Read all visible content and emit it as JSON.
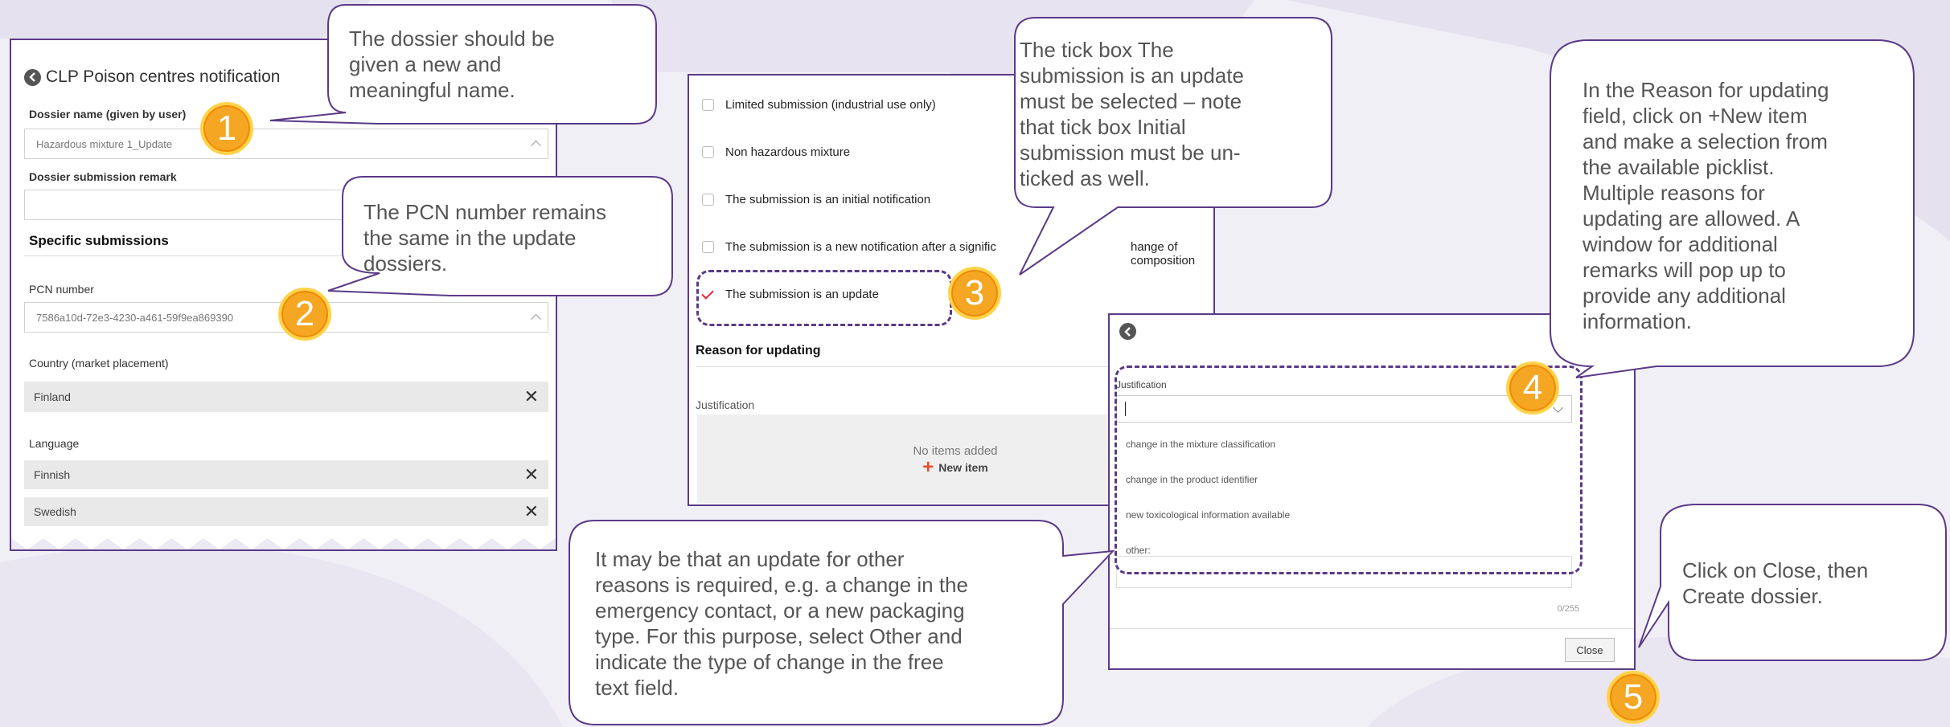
{
  "panel1": {
    "title": "CLP Poison centres notification",
    "dossier_name_label": "Dossier name (given by user)",
    "dossier_name_value": "Hazardous mixture 1_Update",
    "remark_label": "Dossier submission remark",
    "remark_value": "",
    "specific_submissions_heading": "Specific submissions",
    "pcn_label": "PCN number",
    "pcn_value": "7586a10d-72e3-4230-a461-59f9ea869390",
    "country_label": "Country (market placement)",
    "countries": [
      "Finland"
    ],
    "language_label": "Language",
    "languages": [
      "Finnish",
      "Swedish"
    ]
  },
  "panel2": {
    "checkboxes": [
      {
        "label": "Limited submission (industrial use only)",
        "checked": false
      },
      {
        "label": "Non hazardous mixture",
        "checked": false
      },
      {
        "label": "The submission is an initial notification",
        "checked": false
      },
      {
        "label": "The submission is a new notification after a signific",
        "checked": false
      },
      {
        "label": "The submission is an update",
        "checked": true
      }
    ],
    "checkbox4_tail": "hange of composition",
    "reason_heading": "Reason for updating",
    "justification_label": "Justification",
    "no_items_text": "No items added",
    "new_item_label": "New item"
  },
  "panel3": {
    "justification_label": "Justification",
    "options": [
      "change in the mixture classification",
      "change in the product identifier",
      "new toxicological information available",
      "other:"
    ],
    "counter": "0/255",
    "close_label": "Close"
  },
  "callouts": {
    "c1": [
      "The dossier should be",
      "given a new and",
      "meaningful name."
    ],
    "c2": [
      "The PCN number remains",
      "the same in the update",
      "dossiers."
    ],
    "c3": [
      "The tick box The",
      "submission is an update",
      "must be selected – note",
      "that tick box Initial",
      "submission must be un-",
      "ticked as well."
    ],
    "c4": [
      "In the Reason for updating",
      "field, click on +New item",
      "and make a selection from",
      "the available picklist.",
      "Multiple reasons for",
      "updating are allowed. A",
      "window for additional",
      "remarks will pop up to",
      "provide any additional",
      "information."
    ],
    "c5": [
      "Click on Close, then",
      "Create dossier."
    ],
    "c6": [
      "It may be that an update for other",
      "reasons is required, e.g. a change in the",
      "emergency contact, or a new packaging",
      "type. For this purpose, select Other and",
      "indicate the type of change in the free",
      "text field."
    ]
  },
  "badges": [
    "1",
    "2",
    "3",
    "4",
    "5"
  ],
  "colors": {
    "accent": "#5b3a88",
    "badge": "#f5a623",
    "check": "#e22244",
    "plus": "#e0502f"
  }
}
